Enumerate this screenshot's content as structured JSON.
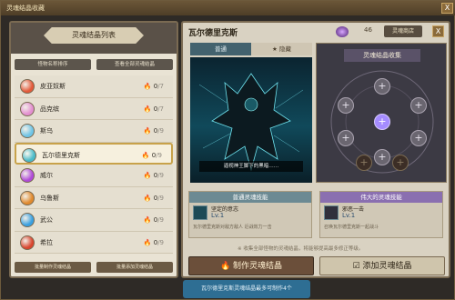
{
  "window": {
    "title": "灵魂结晶收藏",
    "close_label": "X"
  },
  "left_panel": {
    "title": "灵魂结晶列表",
    "filter_sort": "怪物名称排序",
    "filter_view": "查看全部灵魂结晶",
    "monsters": [
      {
        "name": "皮亚奴斯",
        "count": "0",
        "max": "/7",
        "gem_color": "#e35a3a"
      },
      {
        "name": "品克缤",
        "count": "0",
        "max": "/7",
        "gem_color": "#e38fd0"
      },
      {
        "name": "斯乌",
        "count": "0",
        "max": "/9",
        "gem_color": "#6fc4e6"
      },
      {
        "name": "瓦尔德里克斯",
        "count": "0",
        "max": "/9",
        "gem_color": "#4bbbc8"
      },
      {
        "name": "威尔",
        "count": "0",
        "max": "/9",
        "gem_color": "#b04bd8"
      },
      {
        "name": "乌鲁斯",
        "count": "0",
        "max": "/9",
        "gem_color": "#e08a2e"
      },
      {
        "name": "武公",
        "count": "0",
        "max": "/9",
        "gem_color": "#3aa0e0"
      },
      {
        "name": "希拉",
        "count": "0",
        "max": "/9",
        "gem_color": "#d8462f"
      }
    ],
    "bottom_buttons": [
      "批量制作灵魂结晶",
      "批量添加灵魂结晶"
    ]
  },
  "right_panel": {
    "monster_name": "瓦尔德里克斯",
    "soul_count": "46",
    "shop_label": "灵魂商店",
    "close_label": "X",
    "tabs": [
      "普通",
      "隐藏"
    ],
    "art_caption": "逼视神王脚下的黑暗……",
    "collection_title": "灵魂结晶收集",
    "normal_skill": {
      "header": "普通灵魂技能",
      "name": "坚定的意志",
      "level": "Lv.1",
      "desc": "瓦尔德里克斯对敌方敌人 近战效力一击"
    },
    "great_skill": {
      "header": "伟大的灵魂技能",
      "name": "邪恶一击",
      "level": "Lv.1",
      "desc": "召唤瓦尔德里克斯一起战斗"
    },
    "note": "※ 收集全部怪物的灵魂结晶，将能够提高最多修正等级。",
    "make_button": "制作灵魂结晶",
    "add_button": "添加灵魂结晶"
  },
  "toast": "瓦尔德里克斯灵魂结晶最多可制作4个",
  "colors": {
    "frame": "#7a6a52",
    "accent_blue": "#43626e",
    "accent_purple": "#a58cff"
  }
}
